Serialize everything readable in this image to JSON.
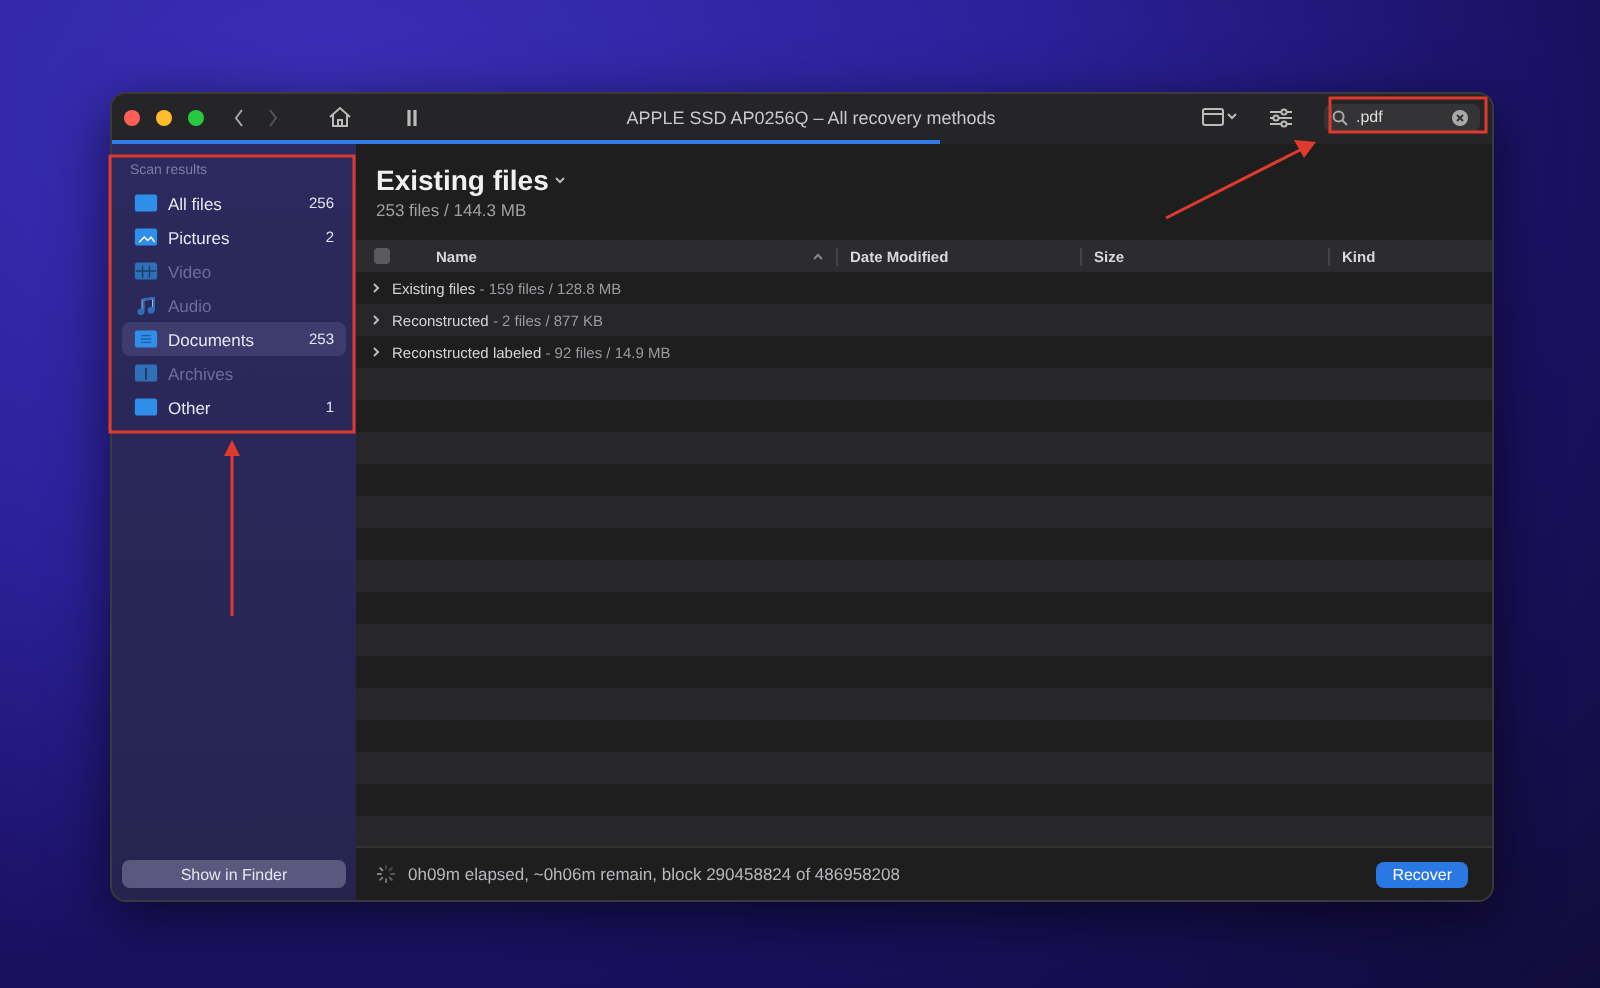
{
  "window": {
    "title": "APPLE SSD AP0256Q – All recovery methods",
    "progress": {
      "level": 0.6
    }
  },
  "search": {
    "value": ".pdf"
  },
  "sidebar": {
    "heading": "Scan results",
    "items": [
      {
        "kind": "all",
        "label": "All files",
        "count": "256",
        "selected": false,
        "disabled": false
      },
      {
        "kind": "pictures",
        "label": "Pictures",
        "count": "2",
        "selected": false,
        "disabled": false
      },
      {
        "kind": "video",
        "label": "Video",
        "selected": false,
        "disabled": true
      },
      {
        "kind": "audio",
        "label": "Audio",
        "selected": false,
        "disabled": true
      },
      {
        "kind": "documents",
        "label": "Documents",
        "count": "253",
        "selected": true,
        "disabled": false
      },
      {
        "kind": "archives",
        "label": "Archives",
        "selected": false,
        "disabled": true
      },
      {
        "kind": "other",
        "label": "Other",
        "count": "1",
        "selected": false,
        "disabled": false
      }
    ],
    "button": "Show in Finder"
  },
  "content": {
    "title": "Existing files",
    "subtitle": "253 files / 144.3 MB"
  },
  "table": {
    "select_all": {
      "checked": false
    },
    "columns": [
      "Name",
      "Date Modified",
      "Size",
      "Kind"
    ],
    "groups": [
      {
        "name": "Existing files",
        "summary": " - 159 files / 128.8 MB",
        "expanded": false
      },
      {
        "name": "Reconstructed",
        "summary": " - 2 files / 877 KB",
        "expanded": false
      },
      {
        "name": "Reconstructed labeled",
        "summary": " - 92 files / 14.9 MB",
        "expanded": false
      }
    ]
  },
  "status_bar": {
    "text": "0h09m elapsed, ~0h06m remain, block 290458824 of 486958208",
    "button": "Recover"
  }
}
